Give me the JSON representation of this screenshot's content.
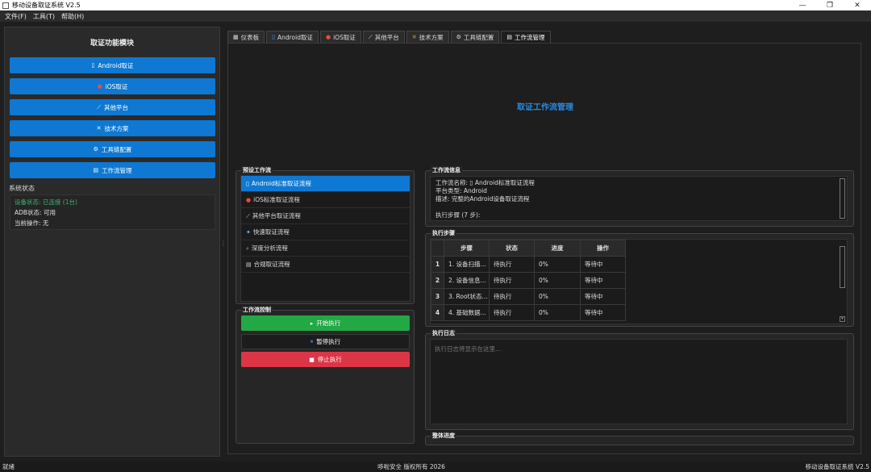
{
  "window": {
    "title": "移动设备取证系统 V2.5",
    "controls": [
      "—",
      "❐",
      "✕"
    ]
  },
  "menu": [
    "文件(F)",
    "工具(T)",
    "帮助(H)"
  ],
  "sidebar": {
    "title": "取证功能模块",
    "buttons": [
      {
        "icon": "▯",
        "label": "Android取证"
      },
      {
        "icon": "●",
        "label": "iOS取证"
      },
      {
        "icon": "⟋",
        "label": "其他平台"
      },
      {
        "icon": "✕",
        "label": "技术方案"
      },
      {
        "icon": "⚙",
        "label": "工具链配置"
      },
      {
        "icon": "▤",
        "label": "工作流管理"
      }
    ],
    "status_title": "系统状态",
    "status": [
      "设备状态: 已连接 (1台)",
      "ADB状态: 可用",
      "当前操作: 无"
    ]
  },
  "tabs": [
    {
      "icon": "▦",
      "label": "仪表板"
    },
    {
      "icon": "▯",
      "label": "Android取证"
    },
    {
      "icon": "●",
      "label": "iOS取证"
    },
    {
      "icon": "⟋",
      "label": "其他平台"
    },
    {
      "icon": "✕",
      "label": "技术方案"
    },
    {
      "icon": "⚙",
      "label": "工具链配置"
    },
    {
      "icon": "▤",
      "label": "工作流管理"
    }
  ],
  "page": {
    "heading": "取证工作流管理",
    "preset_title": "预设工作流",
    "workflows": [
      {
        "icon": "▯",
        "label": "Android标准取证流程"
      },
      {
        "icon": "●",
        "label": "iOS标准取证流程"
      },
      {
        "icon": "⟋",
        "label": "其他平台取证流程"
      },
      {
        "icon": "✦",
        "label": "快速取证流程"
      },
      {
        "icon": "⌕",
        "label": "深度分析流程"
      },
      {
        "icon": "▤",
        "label": "合规取证流程"
      }
    ],
    "control_title": "工作流控制",
    "start_label": "开始执行",
    "pause_label": "暂停执行",
    "stop_label": "停止执行",
    "info_title": "工作流信息",
    "info_lines": [
      "工作流名称: ▯ Android标准取证流程",
      "平台类型: Android",
      "描述: 完整的Android设备取证流程",
      "",
      "执行步骤 (7 步):"
    ],
    "steps_title": "执行步骤",
    "table_headers": [
      "步骤",
      "状态",
      "进度",
      "操作"
    ],
    "steps": [
      {
        "n": "1",
        "step": "1. 设备扫描...",
        "status": "待执行",
        "progress": "0%",
        "action": "等待中"
      },
      {
        "n": "2",
        "step": "2. 设备信息...",
        "status": "待执行",
        "progress": "0%",
        "action": "等待中"
      },
      {
        "n": "3",
        "step": "3. Root状态...",
        "status": "待执行",
        "progress": "0%",
        "action": "等待中"
      },
      {
        "n": "4",
        "step": "4. 基础数据...",
        "status": "待执行",
        "progress": "0%",
        "action": "等待中"
      }
    ],
    "log_title": "执行日志",
    "log_placeholder": "执行日志将显示在这里...",
    "overall_title": "整体进度"
  },
  "statusbar": {
    "left": "就绪",
    "center": "哆啦安全 版权所有 2026",
    "right": "移动设备取证系统 V2.5"
  },
  "colors": {
    "primary": "#0e78d2",
    "success": "#22a845",
    "danger": "#dc3545",
    "heading": "#2b8be0"
  }
}
